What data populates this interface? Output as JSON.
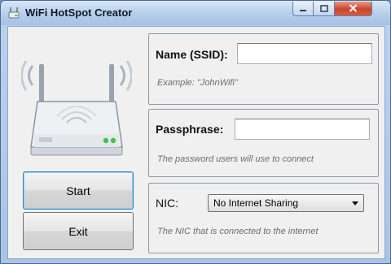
{
  "window": {
    "title": "WiFi HotSpot Creator"
  },
  "icons": {
    "app": "wifi-router-icon",
    "minimize": "minimize-icon",
    "maximize": "maximize-icon",
    "close": "close-icon",
    "router": "wifi-router-icon",
    "dropdown": "chevron-down-icon"
  },
  "ssid": {
    "label": "Name (SSID):",
    "value": "",
    "hint": "Example: \"JohnWifi\""
  },
  "passphrase": {
    "label": "Passphrase:",
    "value": "",
    "hint": "The password users will use to connect"
  },
  "nic": {
    "label": "NIC:",
    "selected": "No Internet Sharing",
    "hint": "The NIC that is connected to the internet"
  },
  "buttons": {
    "start": "Start",
    "exit": "Exit"
  },
  "colors": {
    "accent": "#3c7fb1",
    "close_button": "#c9452c",
    "router_led": "#42c24a"
  }
}
